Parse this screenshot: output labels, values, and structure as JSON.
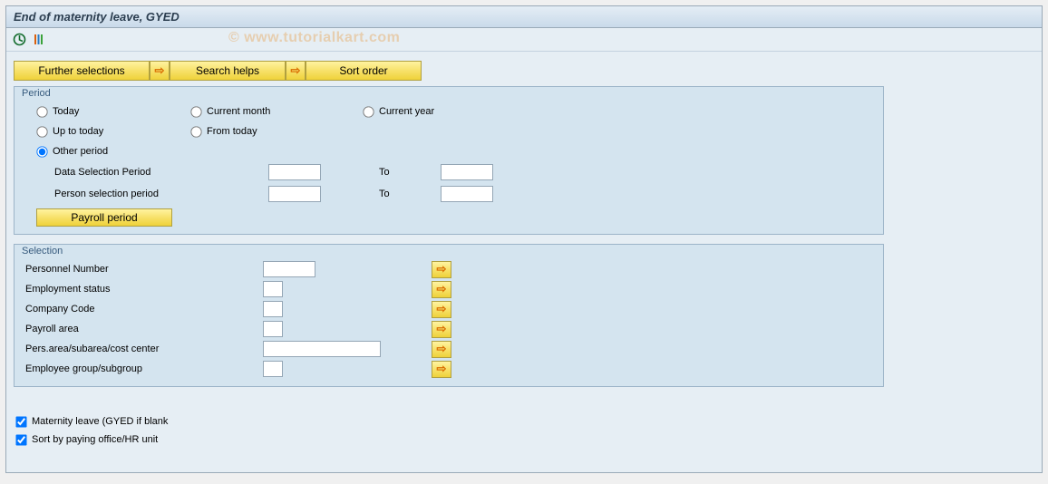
{
  "title": "End of maternity leave, GYED",
  "watermark": "© www.tutorialkart.com",
  "buttons": {
    "further_selections": "Further selections",
    "search_helps": "Search helps",
    "sort_order": "Sort order",
    "payroll_period": "Payroll period"
  },
  "period": {
    "title": "Period",
    "today": "Today",
    "current_month": "Current month",
    "current_year": "Current year",
    "up_to_today": "Up to today",
    "from_today": "From today",
    "other_period": "Other period",
    "data_sel_label": "Data Selection Period",
    "person_sel_label": "Person selection period",
    "to": "To",
    "data_from": "",
    "data_to": "",
    "person_from": "",
    "person_to": ""
  },
  "selection": {
    "title": "Selection",
    "rows": [
      {
        "label": "Personnel Number",
        "width": "w60",
        "value": ""
      },
      {
        "label": "Employment status",
        "width": "w40",
        "value": ""
      },
      {
        "label": "Company Code",
        "width": "w40",
        "value": ""
      },
      {
        "label": "Payroll area",
        "width": "w40",
        "value": ""
      },
      {
        "label": "Pers.area/subarea/cost center",
        "width": "w120",
        "value": ""
      },
      {
        "label": "Employee group/subgroup",
        "width": "w40",
        "value": ""
      }
    ]
  },
  "checks": {
    "maternity": "Maternity leave (GYED if blank",
    "sort_by": "Sort by paying office/HR unit"
  }
}
